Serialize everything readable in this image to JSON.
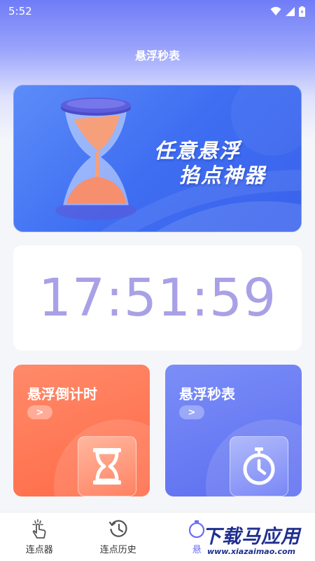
{
  "status_bar": {
    "time": "5:52"
  },
  "header": {
    "title": "悬浮秒表"
  },
  "banner": {
    "line1": "任意悬浮",
    "line2": "掐点神器"
  },
  "clock": {
    "time": "17:51:59"
  },
  "cards": [
    {
      "title": "悬浮倒计时",
      "arrow": ">",
      "icon": "hourglass-icon"
    },
    {
      "title": "悬浮秒表",
      "arrow": ">",
      "icon": "stopwatch-icon"
    }
  ],
  "bottom_nav": {
    "items": [
      {
        "label": "连点器",
        "icon": "tap-icon"
      },
      {
        "label": "连点历史",
        "icon": "history-icon"
      },
      {
        "label": "悬",
        "icon": "stopwatch-icon"
      },
      {
        "label": "",
        "icon": ""
      }
    ]
  },
  "watermark": {
    "main": "下载马应用",
    "sub": "www.xiazaimao.com"
  },
  "colors": {
    "accent": "#6a6ff2",
    "clock_text": "#a9a1e6",
    "countdown_card": "#ff6a46",
    "stopwatch_card": "#5c6df0"
  }
}
